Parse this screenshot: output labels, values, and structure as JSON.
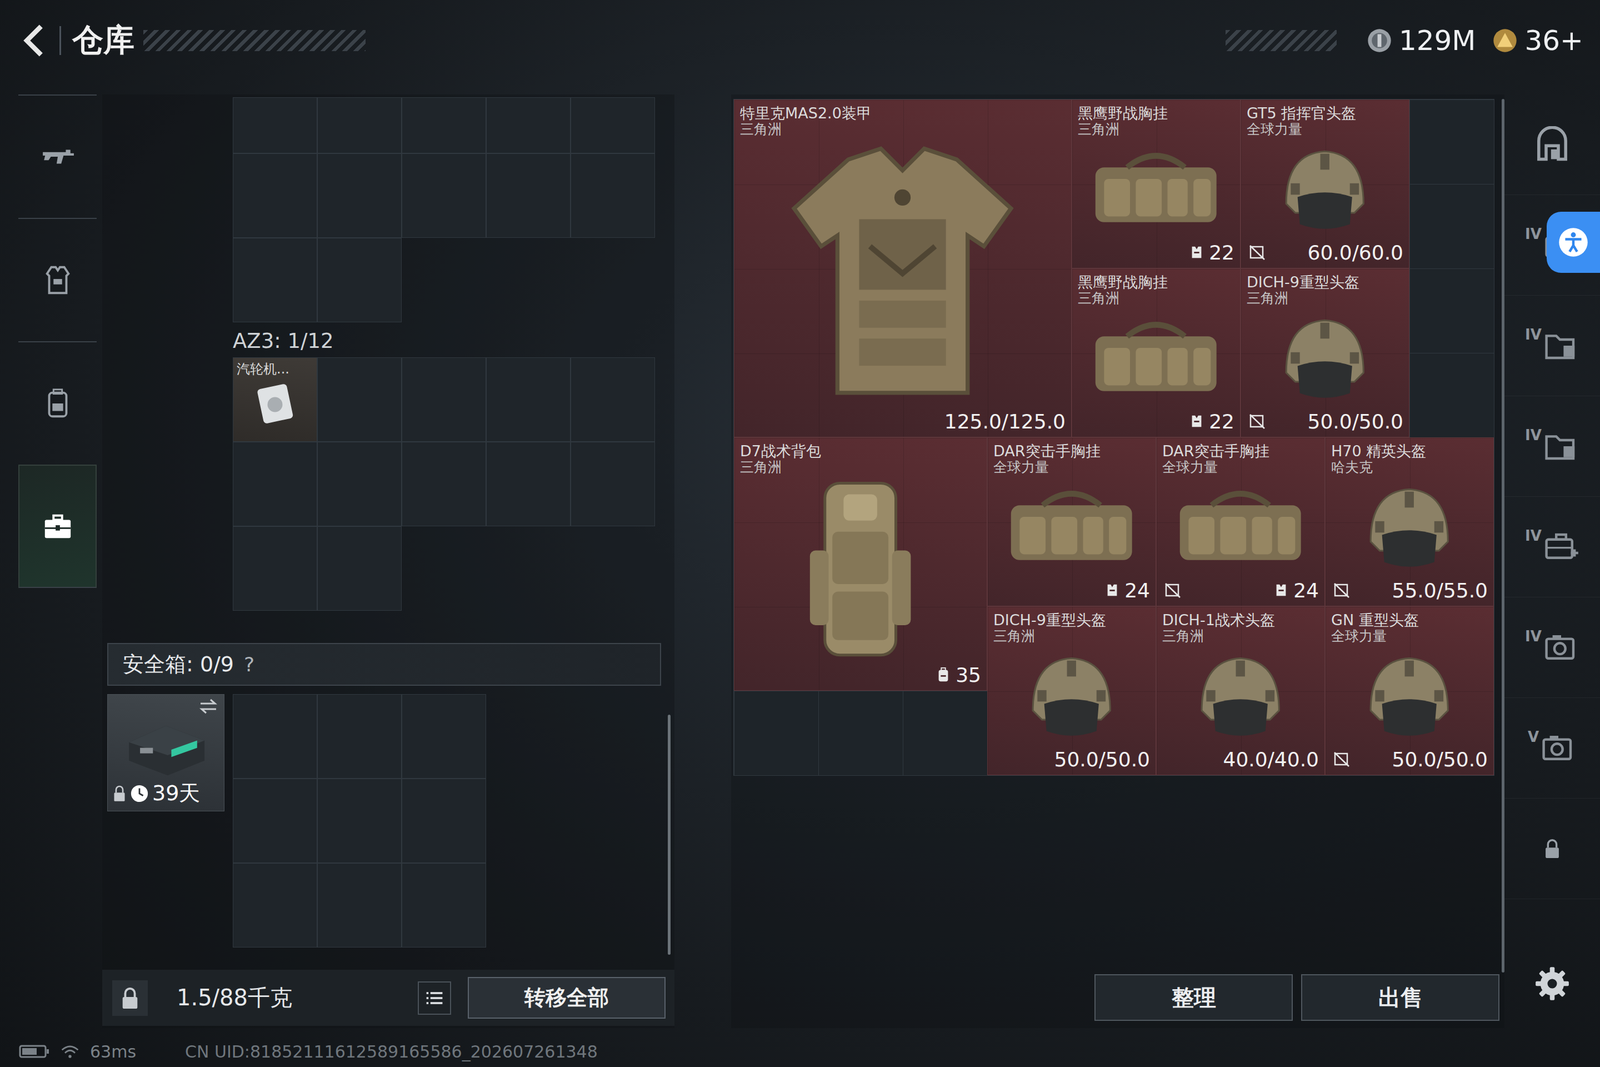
{
  "header": {
    "title": "仓库"
  },
  "currencies": [
    {
      "amount": "129M",
      "kind": "coin"
    },
    {
      "amount": "36+",
      "kind": "token"
    }
  ],
  "nav_tabs": [
    {
      "kind": "weapon",
      "selected": false
    },
    {
      "kind": "armor",
      "selected": false
    },
    {
      "kind": "bag",
      "selected": false
    },
    {
      "kind": "case",
      "selected": true
    }
  ],
  "containers": [
    {
      "label": "AZ3: 1/12",
      "items": [
        {
          "name": "汽轮机..."
        }
      ]
    }
  ],
  "safe_box": {
    "label": "安全箱: 0/9",
    "help": "?",
    "item": {
      "locked": true,
      "timer": "39天"
    }
  },
  "weight": "1.5/88千克",
  "transfer_button": "转移全部",
  "stash": [
    {
      "name": "特里克MAS2.0装甲",
      "brand": "三角洲",
      "kind": "armor",
      "stat": "125.0/125.0",
      "marked": false
    },
    {
      "name": "黑鹰野战胸挂",
      "brand": "三角洲",
      "kind": "rig",
      "stat": "22",
      "marked": false
    },
    {
      "name": "GT5 指挥官头盔",
      "brand": "全球力量",
      "kind": "helmet",
      "stat": "60.0/60.0",
      "marked": true
    },
    {
      "name": "黑鹰野战胸挂",
      "brand": "三角洲",
      "kind": "rig",
      "stat": "22",
      "marked": false
    },
    {
      "name": "DICH-9重型头盔",
      "brand": "三角洲",
      "kind": "helmet",
      "stat": "50.0/50.0",
      "marked": true
    },
    {
      "name": "D7战术背包",
      "brand": "三角洲",
      "kind": "backpack",
      "stat": "35",
      "marked": false
    },
    {
      "name": "DAR突击手胸挂",
      "brand": "全球力量",
      "kind": "rig",
      "stat": "24",
      "marked": false
    },
    {
      "name": "DAR突击手胸挂",
      "brand": "全球力量",
      "kind": "rig",
      "stat": "24",
      "marked": true
    },
    {
      "name": "H70 精英头盔",
      "brand": "哈夫克",
      "kind": "helmet",
      "stat": "55.0/55.0",
      "marked": true
    },
    {
      "name": "DICH-9重型头盔",
      "brand": "三角洲",
      "kind": "helmet",
      "stat": "50.0/50.0",
      "marked": false
    },
    {
      "name": "DICH-1战术头盔",
      "brand": "三角洲",
      "kind": "helmet",
      "stat": "40.0/40.0",
      "marked": false
    },
    {
      "name": "GN 重型头盔",
      "brand": "全球力量",
      "kind": "helmet",
      "stat": "50.0/50.0",
      "marked": true
    }
  ],
  "side_tabs": [
    {
      "tier": null,
      "kind": "arch",
      "selected": false
    },
    {
      "tier": "IV",
      "kind": "case",
      "selected": false
    },
    {
      "tier": "IV",
      "kind": "folder",
      "selected": false
    },
    {
      "tier": "IV",
      "kind": "folder",
      "selected": false
    },
    {
      "tier": "IV",
      "kind": "case-plus",
      "selected": false
    },
    {
      "tier": "IV",
      "kind": "camera",
      "selected": false
    },
    {
      "tier": "V",
      "kind": "camera",
      "selected": false
    },
    {
      "tier": null,
      "kind": "lock",
      "selected": false
    }
  ],
  "buttons": [
    "整理",
    "出售"
  ],
  "status_bar": {
    "ping": "63ms",
    "uid": "CN UID:81852111612589165586_202607261348"
  }
}
